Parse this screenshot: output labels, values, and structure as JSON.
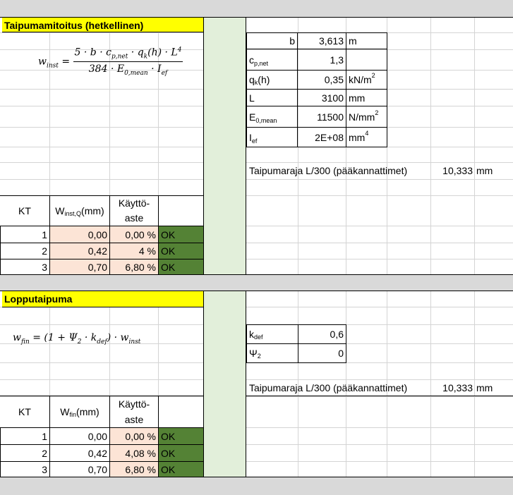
{
  "section1": {
    "title": "Taipumamitoitus (hetkellinen)",
    "formula": {
      "lhs": "w",
      "lhs_sub": "inst",
      "num": "5 · b · c",
      "num_sub": "p,net",
      "num_mid": " · q",
      "num_sub2": "k",
      "num_end": "(h) · L",
      "num_sup": "4",
      "den": "384 · E",
      "den_sub": "0,mean",
      "den_mid": " · I",
      "den_sub2": "ef"
    },
    "params": [
      {
        "name": "b",
        "name_sub": "",
        "value": "3,613",
        "unit": "m",
        "unit_sup": ""
      },
      {
        "name": "c",
        "name_sub": "p,net",
        "value": "1,3",
        "unit": "",
        "unit_sup": ""
      },
      {
        "name": "q",
        "name_sub": "k",
        "name_suffix": "(h)",
        "value": "0,35",
        "unit": "kN/m",
        "unit_sup": "2"
      },
      {
        "name": "L",
        "name_sub": "",
        "value": "3100",
        "unit": "mm",
        "unit_sup": ""
      },
      {
        "name": "E",
        "name_sub": "0,mean",
        "value": "11500",
        "unit": "N/mm",
        "unit_sup": "2"
      },
      {
        "name": "I",
        "name_sub": "ef",
        "value": "2E+08",
        "unit": "mm",
        "unit_sup": "4"
      }
    ],
    "limit_label": "Taipumaraja L/300 (pääkannattimet)",
    "limit_value": "10,333",
    "limit_unit": "mm",
    "table": {
      "h_kt": "KT",
      "h_w": "W",
      "h_w_sub": "inst,Q",
      "h_w_unit": "(mm)",
      "h_k1": "Käyttö-",
      "h_k2": "aste",
      "rows": [
        {
          "kt": "1",
          "w": "0,00",
          "aste": "0,00 %",
          "status": "OK"
        },
        {
          "kt": "2",
          "w": "0,42",
          "aste": "4 %",
          "status": "OK"
        },
        {
          "kt": "3",
          "w": "0,70",
          "aste": "6,80 %",
          "status": "OK"
        }
      ]
    }
  },
  "section2": {
    "title": "Lopputaipuma",
    "formula": {
      "lhs": "w",
      "lhs_sub": "fin",
      "rhs1": " = (1 + Ψ",
      "rhs_sub1": "2",
      "rhs2": " · k",
      "rhs_sub2": "def",
      "rhs3": ") · w",
      "rhs_sub3": "inst"
    },
    "params": [
      {
        "name": "k",
        "name_sub": "def",
        "value": "0,6"
      },
      {
        "name": "Ψ",
        "name_sub": "2",
        "value": "0"
      }
    ],
    "limit_label": "Taipumaraja L/300 (pääkannattimet)",
    "limit_value": "10,333",
    "limit_unit": "mm",
    "table": {
      "h_kt": "KT",
      "h_w": "W",
      "h_w_sub": "fin",
      "h_w_unit": "(mm)",
      "h_k1": "Käyttö-",
      "h_k2": "aste",
      "rows": [
        {
          "kt": "1",
          "w": "0,00",
          "aste": "0,00 %",
          "status": "OK"
        },
        {
          "kt": "2",
          "w": "0,42",
          "aste": "4,08 %",
          "status": "OK"
        },
        {
          "kt": "3",
          "w": "0,70",
          "aste": "6,80 %",
          "status": "OK"
        }
      ]
    }
  }
}
